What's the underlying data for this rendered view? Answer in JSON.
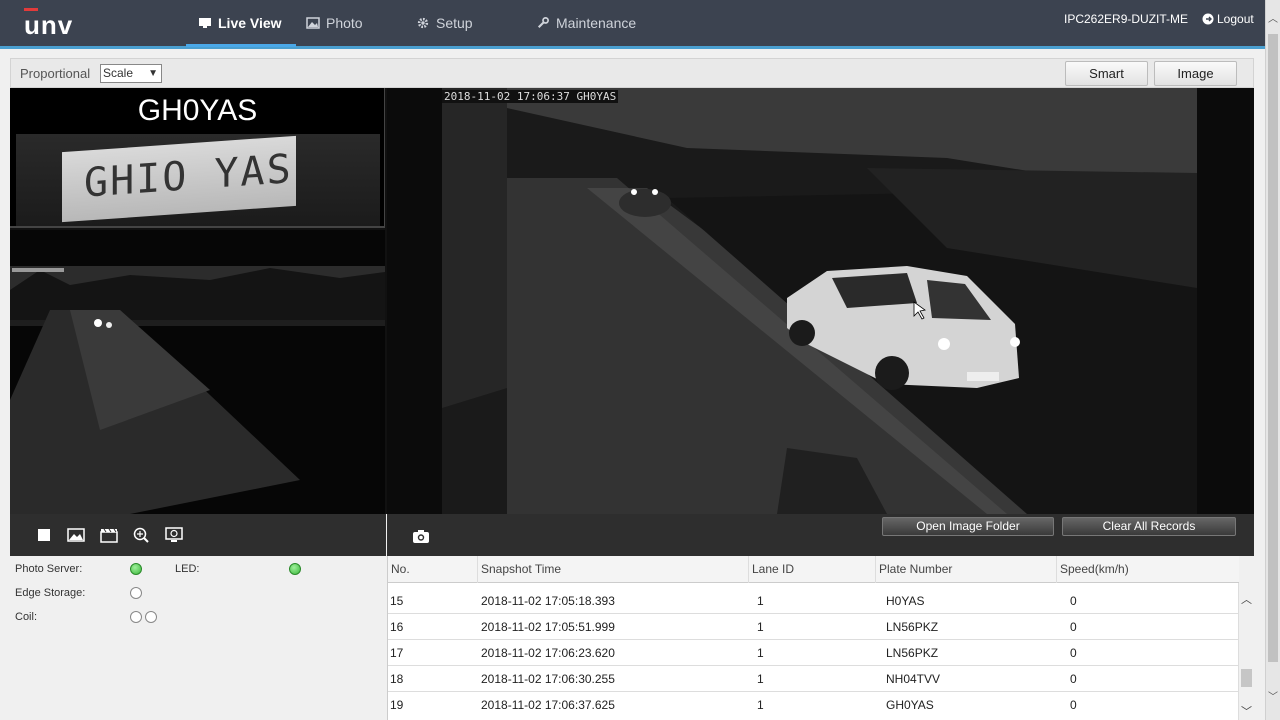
{
  "header": {
    "logo": "unv",
    "nav": [
      {
        "label": "Live View",
        "icon": "monitor-icon"
      },
      {
        "label": "Photo",
        "icon": "image-icon"
      },
      {
        "label": "Setup",
        "icon": "gear-icon"
      },
      {
        "label": "Maintenance",
        "icon": "wrench-icon"
      }
    ],
    "device_name": "IPC262ER9-DUZIT-ME",
    "logout_label": "Logout"
  },
  "toolbar": {
    "proportional_label": "Proportional",
    "scale_value": "Scale",
    "smart_label": "Smart",
    "image_label": "Image"
  },
  "video": {
    "plate_text": "GH0YAS",
    "plate_image_text": "GHIO YAS",
    "osd_timestamp": "2018-11-02 17:06:37 GH0YAS"
  },
  "actions": {
    "open_folder_label": "Open Image Folder",
    "clear_records_label": "Clear All Records"
  },
  "status": {
    "photo_server_label": "Photo Server:",
    "led_label": "LED:",
    "edge_storage_label": "Edge Storage:",
    "coil_label": "Coil:"
  },
  "table": {
    "headers": [
      "No.",
      "Snapshot Time",
      "Lane ID",
      "Plate Number",
      "Speed(km/h)"
    ],
    "rows": [
      [
        "15",
        "2018-11-02 17:05:18.393",
        "1",
        "H0YAS",
        "0"
      ],
      [
        "16",
        "2018-11-02 17:05:51.999",
        "1",
        "LN56PKZ",
        "0"
      ],
      [
        "17",
        "2018-11-02 17:06:23.620",
        "1",
        "LN56PKZ",
        "0"
      ],
      [
        "18",
        "2018-11-02 17:06:30.255",
        "1",
        "NH04TVV",
        "0"
      ],
      [
        "19",
        "2018-11-02 17:06:37.625",
        "1",
        "GH0YAS",
        "0"
      ]
    ]
  },
  "colors": {
    "header_bg": "#3c4350",
    "accent": "#4aa8e8",
    "logo_accent": "#e23b3b",
    "status_green": "#3bb63b"
  }
}
